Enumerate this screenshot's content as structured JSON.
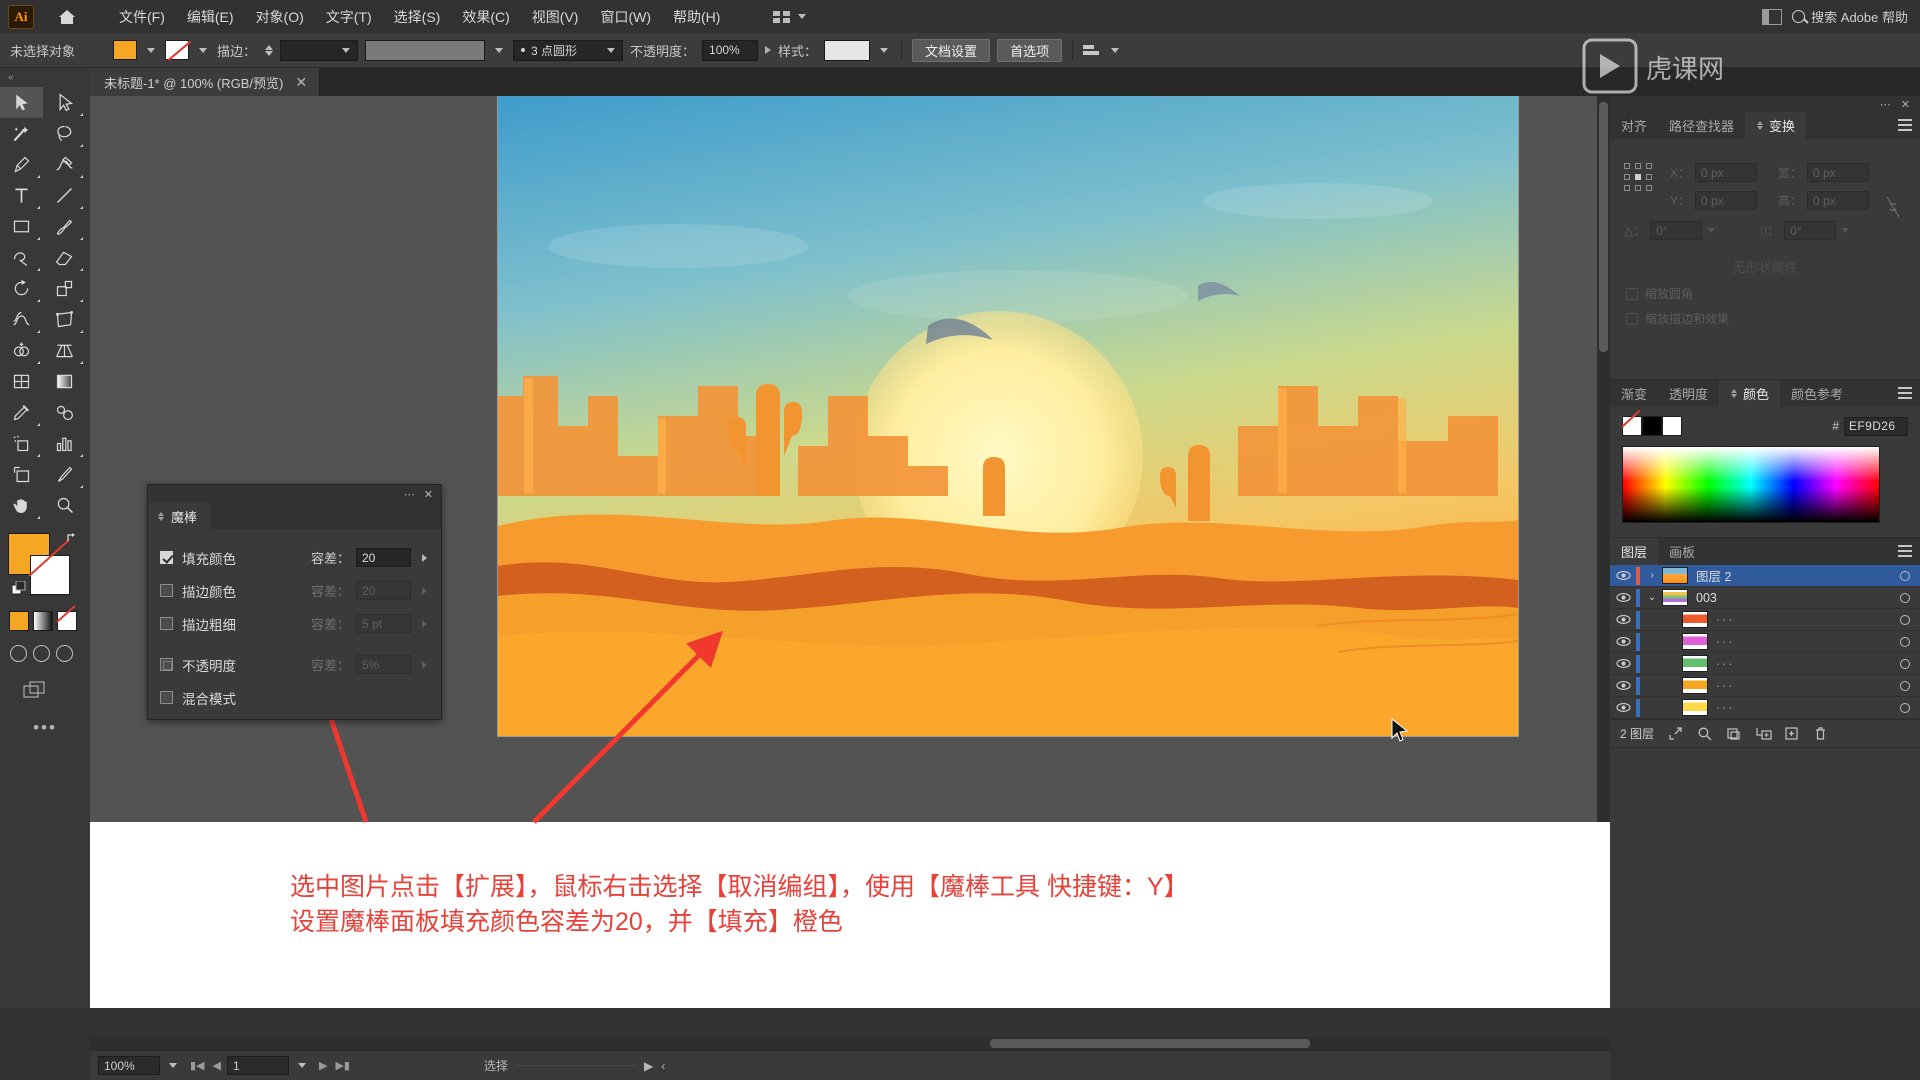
{
  "app": {
    "name": "Ai",
    "logo_label": "Ai"
  },
  "menubar": {
    "items": [
      "文件(F)",
      "编辑(E)",
      "对象(O)",
      "文字(T)",
      "选择(S)",
      "效果(C)",
      "视图(V)",
      "窗口(W)",
      "帮助(H)"
    ],
    "search_placeholder": "搜索 Adobe 帮助",
    "home_icon": "home-icon",
    "workspace_icon": "workspace-grid-icon",
    "window_icon": "arrange-documents-icon"
  },
  "controlbar": {
    "selection_status": "未选择对象",
    "fill_color": "#F5A623",
    "stroke_color": "none",
    "stroke_label": "描边：",
    "stroke_weight": "",
    "profile": "",
    "brush_def": "3 点圆形",
    "opacity_label": "不透明度：",
    "opacity_value": "100%",
    "style_label": "样式：",
    "doc_setup": "文档设置",
    "preferences": "首选项",
    "align_icon": "align-icon"
  },
  "document": {
    "tab_title": "未标题-1* @ 100% (RGB/预览)",
    "close_icon": "close-icon"
  },
  "toolbar": {
    "tools": [
      {
        "name": "selection-tool",
        "icon": "arrow-cursor",
        "active": true
      },
      {
        "name": "direct-selection-tool",
        "icon": "white-arrow-cursor",
        "active": false
      },
      {
        "name": "magic-wand-tool",
        "icon": "magic-wand",
        "active": false
      },
      {
        "name": "lasso-tool",
        "icon": "lasso",
        "active": false
      },
      {
        "name": "pen-tool",
        "icon": "pen",
        "active": false
      },
      {
        "name": "curvature-tool",
        "icon": "curvature",
        "active": false
      },
      {
        "name": "type-tool",
        "icon": "type-T",
        "active": false
      },
      {
        "name": "line-segment-tool",
        "icon": "line",
        "active": false
      },
      {
        "name": "rectangle-tool",
        "icon": "rectangle",
        "active": false
      },
      {
        "name": "paintbrush-tool",
        "icon": "paintbrush",
        "active": false
      },
      {
        "name": "shaper-tool",
        "icon": "shaper",
        "active": false
      },
      {
        "name": "eraser-tool",
        "icon": "eraser",
        "active": false
      },
      {
        "name": "rotate-tool",
        "icon": "rotate",
        "active": false
      },
      {
        "name": "scale-tool",
        "icon": "scale",
        "active": false
      },
      {
        "name": "width-tool",
        "icon": "width",
        "active": false
      },
      {
        "name": "free-transform-tool",
        "icon": "free-transform",
        "active": false
      },
      {
        "name": "shape-builder-tool",
        "icon": "shape-builder",
        "active": false
      },
      {
        "name": "perspective-grid-tool",
        "icon": "perspective-grid",
        "active": false
      },
      {
        "name": "mesh-tool",
        "icon": "mesh",
        "active": false
      },
      {
        "name": "gradient-tool",
        "icon": "gradient",
        "active": false
      },
      {
        "name": "eyedropper-tool",
        "icon": "eyedropper",
        "active": false
      },
      {
        "name": "blend-tool",
        "icon": "blend",
        "active": false
      },
      {
        "name": "symbol-sprayer-tool",
        "icon": "symbol-sprayer",
        "active": false
      },
      {
        "name": "column-graph-tool",
        "icon": "bar-chart",
        "active": false
      },
      {
        "name": "artboard-tool",
        "icon": "artboard",
        "active": false
      },
      {
        "name": "slice-tool",
        "icon": "slice-knife",
        "active": false
      },
      {
        "name": "hand-tool",
        "icon": "hand",
        "active": false
      },
      {
        "name": "zoom-tool",
        "icon": "magnifier",
        "active": false
      }
    ],
    "fill_swatch": "#F5A623",
    "stroke_swatch": "none",
    "more_tools_icon": "ellipsis-icon",
    "drag_handle": "«"
  },
  "magic_wand_panel": {
    "title": "魔棒",
    "collapse_icon": "collapse-icon",
    "close_icon": "close-icon",
    "rows": [
      {
        "label": "填充颜色",
        "checked": true,
        "enabled": true,
        "tol_label": "容差：",
        "tol_value": "20"
      },
      {
        "label": "描边颜色",
        "checked": false,
        "enabled": false,
        "tol_label": "容差：",
        "tol_value": "20"
      },
      {
        "label": "描边粗细",
        "checked": false,
        "enabled": false,
        "tol_label": "容差：",
        "tol_value": "5 pt"
      },
      {
        "label": "不透明度",
        "checked": false,
        "enabled": false,
        "tol_label": "容差：",
        "tol_value": "5%"
      },
      {
        "label": "混合模式",
        "checked": false,
        "enabled": false,
        "tol_label": "",
        "tol_value": ""
      }
    ]
  },
  "right_dock": {
    "transform_panel": {
      "tabs": [
        "对齐",
        "路径查找器",
        "变换"
      ],
      "active_tab": "变换",
      "fields": [
        {
          "label": "X：",
          "value": "0 px"
        },
        {
          "label": "宽：",
          "value": "0 px"
        },
        {
          "label": "Y：",
          "value": "0 px"
        },
        {
          "label": "高：",
          "value": "0 px"
        },
        {
          "label": "△：",
          "value": "0°"
        },
        {
          "label": "⌷：",
          "value": "0°"
        }
      ],
      "checkboxes": [
        "缩放圆角",
        "缩放描边和效果"
      ],
      "empty_text": "无形状属性",
      "lock_icon": "link-broken-icon",
      "reference_point_icon": "reference-point-grid"
    },
    "color_panel": {
      "tabs": [
        "渐变",
        "透明度",
        "颜色",
        "颜色参考"
      ],
      "active_tab": "颜色",
      "hash": "#",
      "hex_value": "EF9D26",
      "swatches": [
        "none",
        "#000000",
        "#FFFFFF"
      ]
    },
    "layers_panel": {
      "tabs": [
        "图层",
        "画板"
      ],
      "active_tab": "图层",
      "rows": [
        {
          "name": "图层 2",
          "thumb": "t0",
          "selected": true,
          "twisty": "›",
          "bar": "red",
          "indent": 0
        },
        {
          "name": "003",
          "thumb": "t1",
          "selected": false,
          "twisty": "⌄",
          "bar": "blue",
          "indent": 1
        },
        {
          "name": "···",
          "thumb": "t2",
          "selected": false,
          "twisty": "",
          "bar": "blue",
          "indent": 2
        },
        {
          "name": "···",
          "thumb": "t3",
          "selected": false,
          "twisty": "",
          "bar": "blue",
          "indent": 2
        },
        {
          "name": "···",
          "thumb": "t4",
          "selected": false,
          "twisty": "",
          "bar": "blue",
          "indent": 2
        },
        {
          "name": "···",
          "thumb": "t5",
          "selected": false,
          "twisty": "",
          "bar": "blue",
          "indent": 2
        },
        {
          "name": "···",
          "thumb": "t6",
          "selected": false,
          "twisty": "",
          "bar": "blue",
          "indent": 2
        }
      ],
      "footer_count": "2 图层",
      "footer_icons": [
        "locate-object-icon",
        "make-clipping-mask-icon",
        "create-new-sublayer-icon",
        "create-new-layer-icon",
        "delete-selection-icon"
      ]
    }
  },
  "statusbar": {
    "zoom": "100%",
    "page": "1",
    "status_text": "选择",
    "first_icon": "first-page-icon",
    "prev_icon": "prev-page-icon",
    "next_icon": "next-page-icon",
    "last_icon": "last-page-icon"
  },
  "annotation": {
    "line1": "选中图片点击【扩展】，鼠标右击选择【取消编组】，使用【魔棒工具 快捷键：Y】",
    "line2": "设置魔棒面板填充颜色容差为20，并【填充】橙色",
    "color": "#E8413A",
    "arrow_count": 2
  },
  "artwork": {
    "description": "desert-sunset-illustration",
    "sky_top": "#4a9fd0",
    "sky_mid": "#c9d78e",
    "sun": "#fff4a8",
    "sand": "#ffae3c",
    "rock": "#f08a2a",
    "shadow": "#c8521e"
  },
  "watermark": {
    "text": "虎课网"
  }
}
